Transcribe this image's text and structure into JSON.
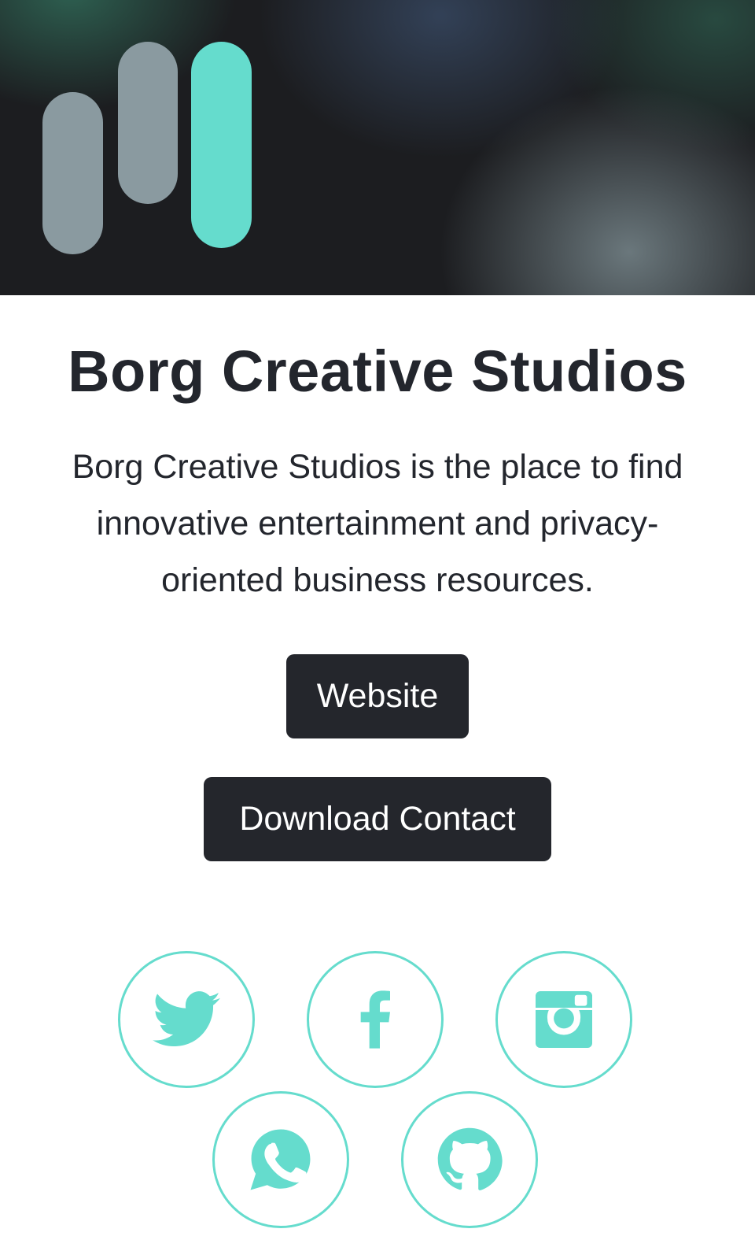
{
  "brand": {
    "accent_color": "#65dccd",
    "logo_gray": "#8a9aa0",
    "dark": "#24262c"
  },
  "profile": {
    "title": "Borg Creative Studios",
    "description": "Borg Creative Studios is the place to find innovative entertainment and privacy-oriented business resources."
  },
  "buttons": {
    "website_label": "Website",
    "download_contact_label": "Download Contact"
  },
  "socials": [
    {
      "icon": "twitter-icon"
    },
    {
      "icon": "facebook-icon"
    },
    {
      "icon": "instagram-icon"
    },
    {
      "icon": "whatsapp-icon"
    },
    {
      "icon": "github-icon"
    }
  ]
}
